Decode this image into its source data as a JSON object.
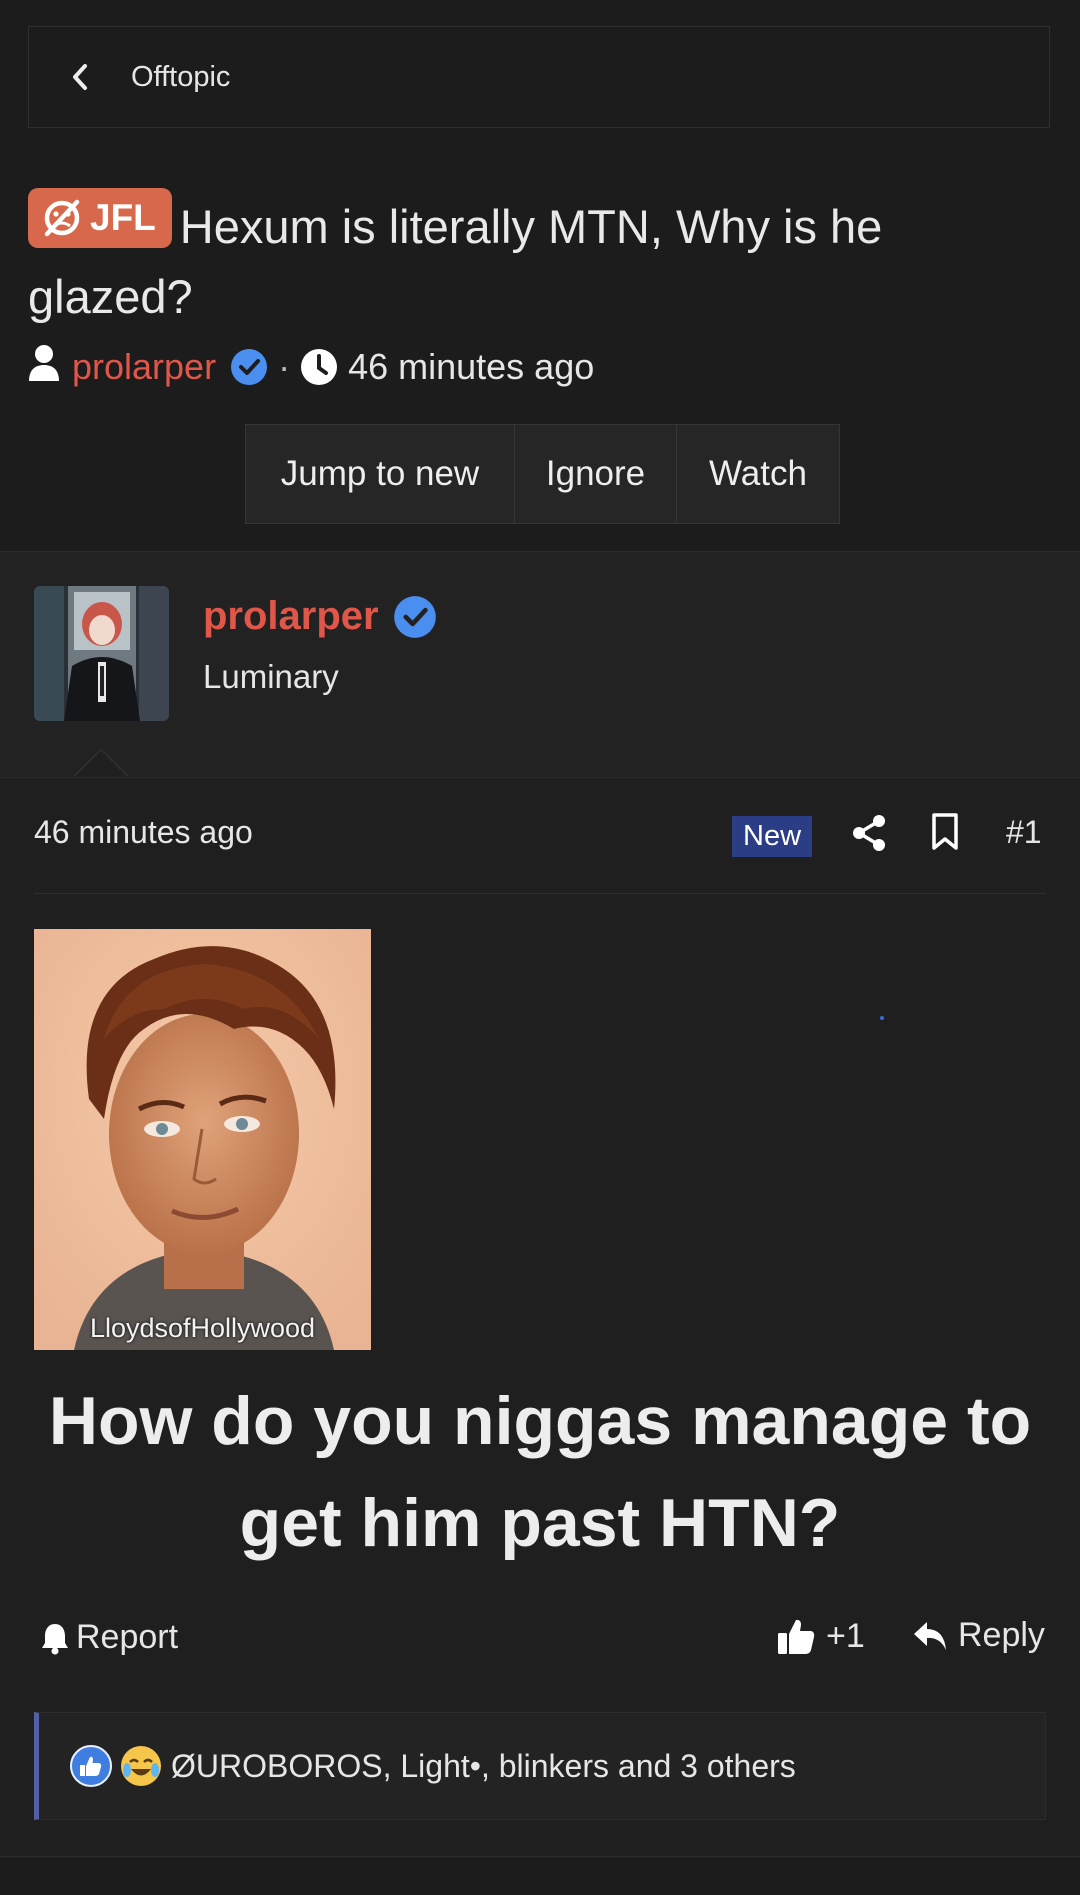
{
  "breadcrumb": {
    "label": "Offtopic"
  },
  "thread": {
    "prefix": "JFL",
    "title": "Hexum is literally MTN, Why is he glazed?",
    "author": "prolarper",
    "separator": "·",
    "time": "46 minutes ago"
  },
  "actions": [
    {
      "label": "Jump to new"
    },
    {
      "label": "Ignore"
    },
    {
      "label": "Watch"
    }
  ],
  "user": {
    "name": "prolarper",
    "title": "Luminary"
  },
  "post": {
    "time": "46 minutes ago",
    "badge": "New",
    "number": "#1",
    "image_watermark": "LloydsofHollywood",
    "text": "How do you niggas manage to get him past HTN?",
    "report_label": "Report",
    "like_count": "+1",
    "reply_label": "Reply",
    "reactions_text": "ØUROBOROS, Light•, blinkers and 3 others"
  },
  "colors": {
    "accent": "#e0574a",
    "prefix_bg": "#d8684b",
    "new_badge": "#2b3d85",
    "verified": "#4a8ff0"
  }
}
